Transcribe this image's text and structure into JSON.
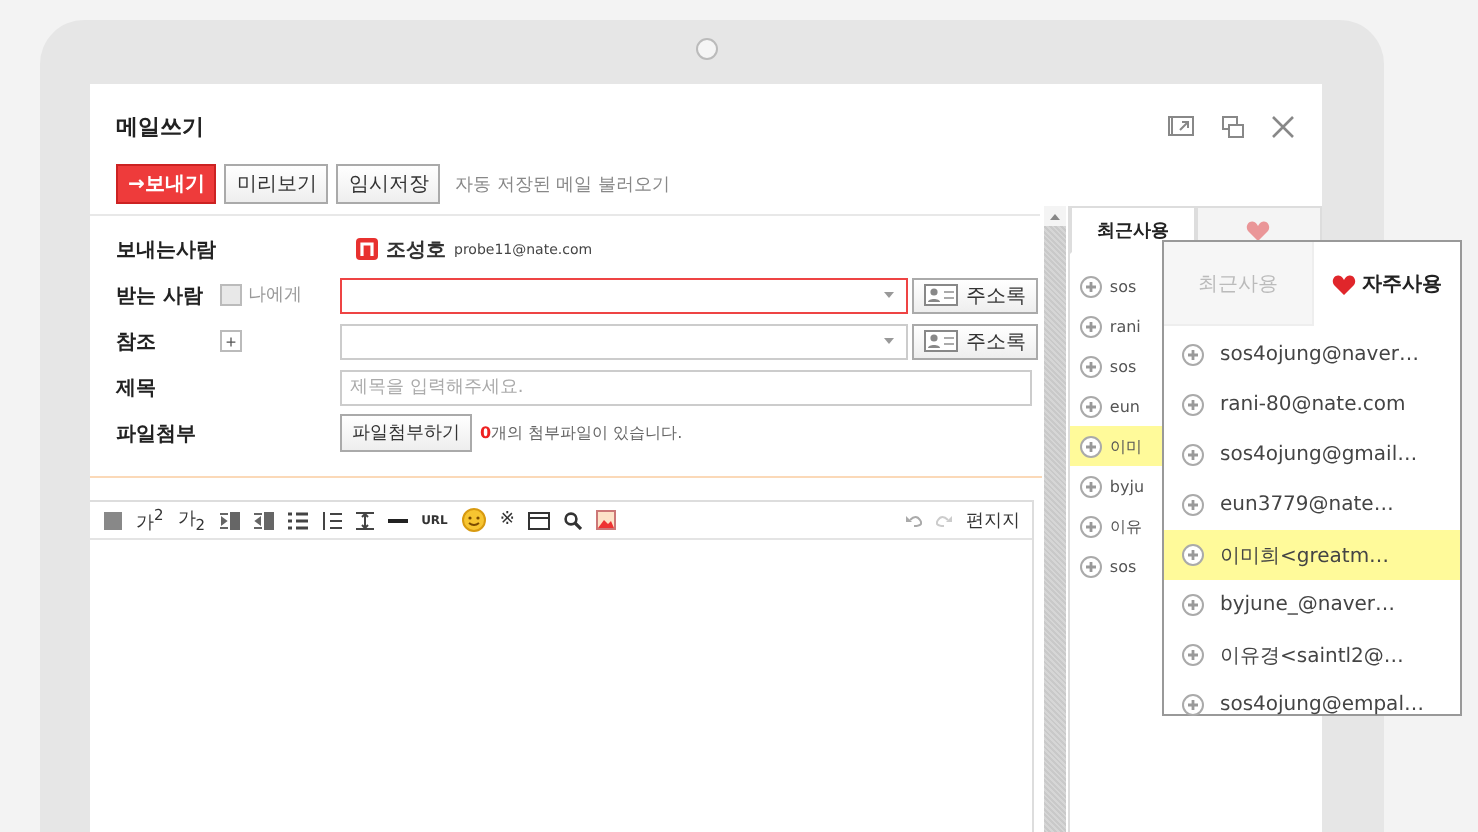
{
  "window": {
    "title": "메일쓰기"
  },
  "actions": {
    "buttons": [
      {
        "label": "보내기",
        "icon": "→",
        "kind": "primary"
      },
      {
        "label": "미리보기",
        "kind": "normal"
      },
      {
        "label": "임시저장",
        "kind": "normal"
      }
    ],
    "link": "자동 저장된 메일 불러오기"
  },
  "form": {
    "sender": {
      "label": "보내는사람",
      "name": "조성호",
      "email": "probe11@nate.com"
    },
    "to": {
      "label": "받는 사람",
      "self_checkbox": {
        "label": "나에게",
        "checked": false
      },
      "focused": true,
      "address_book": "주소록"
    },
    "cc": {
      "label": "참조",
      "expand": "+",
      "address_book": "주소록"
    },
    "subject": {
      "label": "제목",
      "placeholder": "제목을 입력해주세요."
    },
    "attachment": {
      "label": "파일첨부",
      "button": "파일첨부하기",
      "count": "0",
      "note": "개의 첨부파일이 있습니다."
    }
  },
  "editor": {
    "tools": [
      {
        "kind": "shade"
      },
      {
        "kind": "text",
        "text": "가$^{2}$"
      },
      {
        "kind": "text",
        "text": "가$_{2}$"
      },
      {
        "kind": "indent"
      },
      {
        "kind": "outdent"
      },
      {
        "kind": "bullets"
      },
      {
        "kind": "numbers"
      },
      {
        "kind": "height"
      },
      {
        "kind": "rule"
      },
      {
        "kind": "link",
        "text": "URL"
      },
      {
        "kind": "emoji"
      },
      {
        "kind": "symbol",
        "text": "※"
      },
      {
        "kind": "table"
      },
      {
        "kind": "search"
      },
      {
        "kind": "image"
      }
    ],
    "stationery": "편지지"
  },
  "side_panel": {
    "tabs": [
      {
        "label": "최근사용",
        "selected": true
      },
      {
        "kind": "favorite",
        "selected": false
      }
    ],
    "items": [
      {
        "text": "sos",
        "selected": false
      },
      {
        "text": "rani",
        "selected": false
      },
      {
        "text": "sos",
        "selected": false
      },
      {
        "text": "eun",
        "selected": false
      },
      {
        "text": "이미",
        "selected": true
      },
      {
        "text": "byju",
        "selected": false
      },
      {
        "text": "이유",
        "selected": false
      },
      {
        "text": "sos",
        "selected": false
      }
    ]
  },
  "popup": {
    "tabs": [
      {
        "label": "최근사용",
        "selected": false
      },
      {
        "label": "자주사용",
        "selected": true
      }
    ],
    "items": [
      {
        "text": "sos4ojung@naver…",
        "selected": false
      },
      {
        "text": "rani-80@nate.com",
        "selected": false
      },
      {
        "text": "sos4ojung@gmail…",
        "selected": false
      },
      {
        "text": "eun3779@nate…",
        "selected": false
      },
      {
        "text": "이미희<greatm…",
        "selected": true
      },
      {
        "text": "byjune_@naver…",
        "selected": false
      },
      {
        "text": "이유경<saintl2@…",
        "selected": false
      },
      {
        "text": "sos4ojung@empal…",
        "selected": false
      }
    ]
  }
}
